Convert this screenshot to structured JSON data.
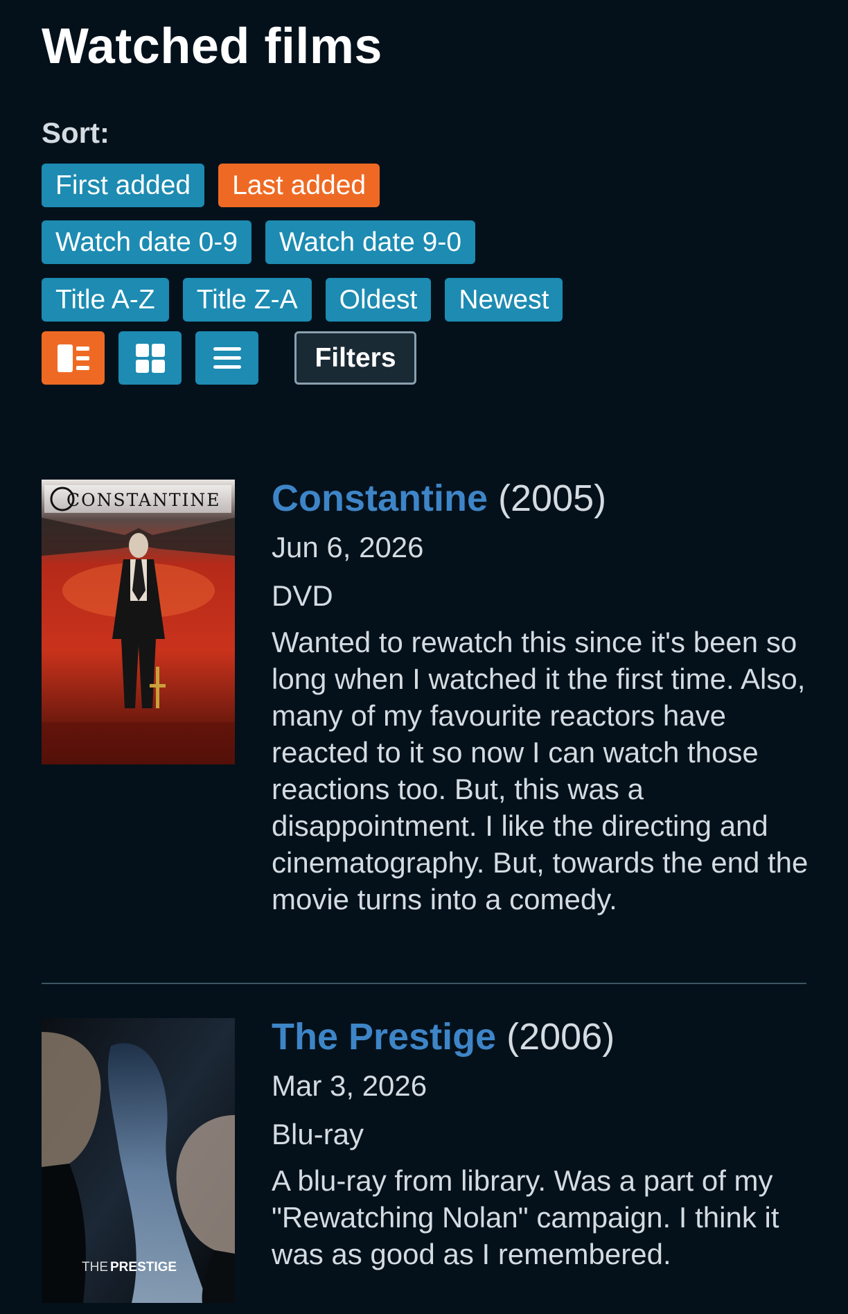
{
  "page": {
    "title": "Watched films"
  },
  "sort": {
    "label": "Sort:",
    "options": [
      {
        "label": "First added",
        "active": false
      },
      {
        "label": "Last added",
        "active": true
      },
      {
        "label": "Watch date 0-9",
        "active": false
      },
      {
        "label": "Watch date 9-0",
        "active": false
      },
      {
        "label": "Title A-Z",
        "active": false
      },
      {
        "label": "Title Z-A",
        "active": false
      },
      {
        "label": "Oldest",
        "active": false
      },
      {
        "label": "Newest",
        "active": false
      }
    ]
  },
  "view_modes": [
    {
      "icon": "detail-view-icon",
      "active": true
    },
    {
      "icon": "grid-view-icon",
      "active": false
    },
    {
      "icon": "list-view-icon",
      "active": false
    }
  ],
  "filters": {
    "label": "Filters"
  },
  "colors": {
    "accent_active": "#ee6a24",
    "button": "#1d8bb2",
    "link": "#3e85c7",
    "background": "#04111b"
  },
  "films": [
    {
      "title": "Constantine",
      "year": "(2005)",
      "date": "Jun 6, 2026",
      "medium": "DVD",
      "review": "Wanted to rewatch this since it's been so long when I watched it the first time. Also, many of my favourite reactors have reacted to it so now I can watch those reactions too. But, this was a disappointment. I like the directing and cinematography. But, towards the end the movie turns into a comedy.",
      "poster_text": "CONSTANTINE"
    },
    {
      "title": "The Prestige",
      "year": "(2006)",
      "date": "Mar 3, 2026",
      "medium": "Blu-ray",
      "review": "A blu-ray from library. Was a part of my \"Rewatching Nolan\" campaign. I think it was as good as I remembered.",
      "poster_text_a": "THE",
      "poster_text_b": "PRESTIGE"
    }
  ]
}
